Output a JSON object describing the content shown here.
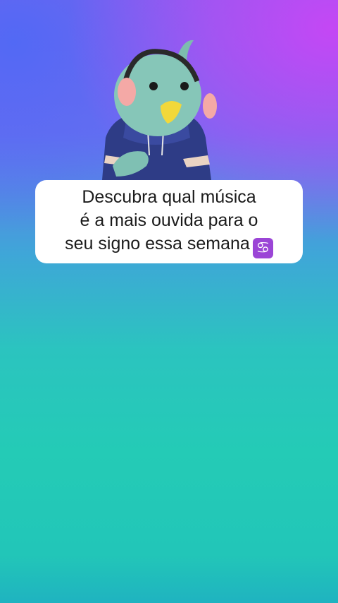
{
  "caption": {
    "lines": [
      "Descubra qual música",
      "é a mais ouvida para o",
      "seu signo essa semana"
    ],
    "emoji": "♋",
    "emoji_name": "cancer-zodiac-icon"
  },
  "mascot": {
    "icon": "bird-plush-mascot"
  },
  "colors": {
    "top_right": "#c846f5",
    "top_left": "#5069f5",
    "middle": "#24cbb6",
    "bottom": "#1fb3c0",
    "card": "#ffffff",
    "text": "#1b1b1b",
    "emoji_badge": "#9b45d6"
  }
}
